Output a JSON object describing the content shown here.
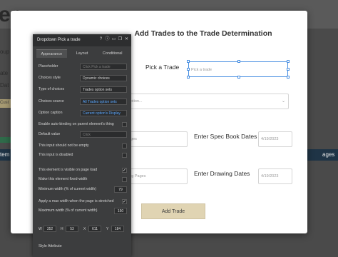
{
  "background": {
    "left_heading_fragment": "er",
    "left_fragment_1": "oup",
    "left_fragment_2": "ate",
    "left_fragment_3": "Dat",
    "left_fragment_4": "Cust",
    "left_fragment_5": "tem",
    "right_fragment": "ages"
  },
  "modal": {
    "title": "Add Trades to the Trade Determination",
    "pick_trade_label": "Pick a Trade",
    "pick_trade_placeholder": "Pick a trade",
    "option_placeholder": "option...",
    "pages_placeholder": "ages",
    "spec_label": "Enter Spec Book Dates",
    "spec_date": "4/19/2023",
    "drawing_pages_placeholder": "ing Pages",
    "drawing_label": "Enter Drawing Dates",
    "drawing_date": "4/19/2023",
    "add_button": "Add Trade"
  },
  "editor": {
    "title": "Dropdown Pick a trade",
    "icons": [
      "help-icon",
      "info-icon",
      "comment-icon",
      "copy-icon",
      "close-icon"
    ],
    "tabs": [
      "Appearance",
      "Layout",
      "Conditional"
    ],
    "rows": {
      "placeholder_label": "Placeholder",
      "placeholder_value": "Click Pick a trade",
      "choices_style_label": "Choices style",
      "choices_style_value": "Dynamic choices",
      "type_label": "Type of choices",
      "type_value": "Trades option sets",
      "source_label": "Choices source",
      "source_value": "All Trades  option sets",
      "caption_label": "Option caption",
      "caption_value": "Current option's Display",
      "autobind_label": "Enable auto-binding on parent element's thing",
      "default_label": "Default value",
      "default_value": "Click",
      "not_empty_label": "This input should not be empty",
      "disabled_label": "This input is disabled",
      "visible_label": "This element is visible on page load",
      "fixed_width_label": "Make this element fixed-width",
      "min_width_label": "Minimum width (% of current width)",
      "min_width_value": "79",
      "max_apply_label": "Apply a max width when the page is stretched",
      "max_width_label": "Maximum width (% of current width)",
      "max_width_value": "150",
      "geo_w_label": "W",
      "geo_w": "352",
      "geo_h_label": "H",
      "geo_h": "53",
      "geo_x_label": "X",
      "geo_x": "611",
      "geo_y_label": "Y",
      "geo_y": "184",
      "style_attr": "Style Attribute"
    },
    "checks": {
      "autobind": false,
      "not_empty": false,
      "disabled": false,
      "visible": true,
      "fixed_width": false,
      "max_apply": true
    }
  }
}
